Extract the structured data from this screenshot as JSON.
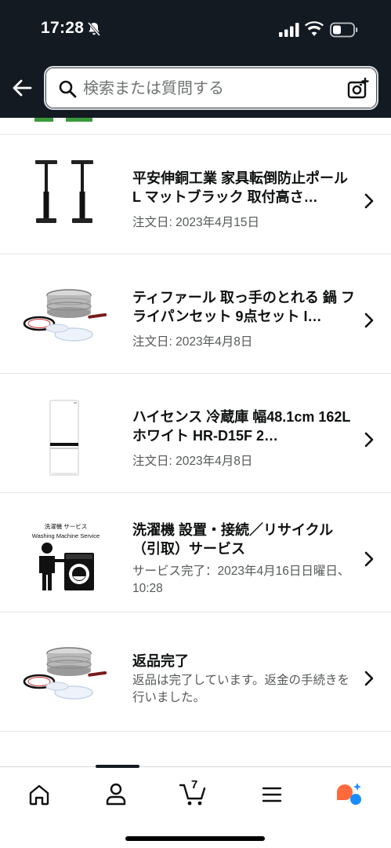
{
  "status_bar": {
    "time": "17:28"
  },
  "search": {
    "placeholder": "検索または質問する"
  },
  "orders": [
    {
      "title": "平安伸銅工業 家具転倒防止ポール L マットブラック 取付高さ…",
      "subtitle": "注文日: 2023年4月15日",
      "thumbnail_icon": "furniture-pole-icon"
    },
    {
      "title": "ティファール 取っ手のとれる 鍋 フライパンセット 9点セット I…",
      "subtitle": "注文日: 2023年4月8日",
      "thumbnail_icon": "cookware-set-icon"
    },
    {
      "title": "ハイセンス 冷蔵庫 幅48.1cm 162L ホワイト HR-D15F 2…",
      "subtitle": "注文日: 2023年4月8日",
      "thumbnail_icon": "refrigerator-icon"
    },
    {
      "title": "洗濯機 設置・接続／リサイクル（引取）サービス",
      "subtitle": "サービス完了：2023年4月16日日曜日、10:28",
      "thumbnail_icon": "washing-machine-service-icon",
      "thumbnail_caption_jp": "洗濯機 サービス",
      "thumbnail_caption_en": "Washing Machine Service"
    },
    {
      "title": "返品完了",
      "subtitle": "返品は完了しています。返金の手続きを行いました。",
      "thumbnail_icon": "cookware-set-icon"
    }
  ],
  "bottom_nav": {
    "cart_count": "7",
    "items": [
      "home-icon",
      "account-icon",
      "cart-icon",
      "menu-icon",
      "assistant-icon"
    ]
  },
  "colors": {
    "header_bg": "#131a22",
    "assistant_orange": "#ff6a3d",
    "assistant_blue": "#1a8cff"
  }
}
